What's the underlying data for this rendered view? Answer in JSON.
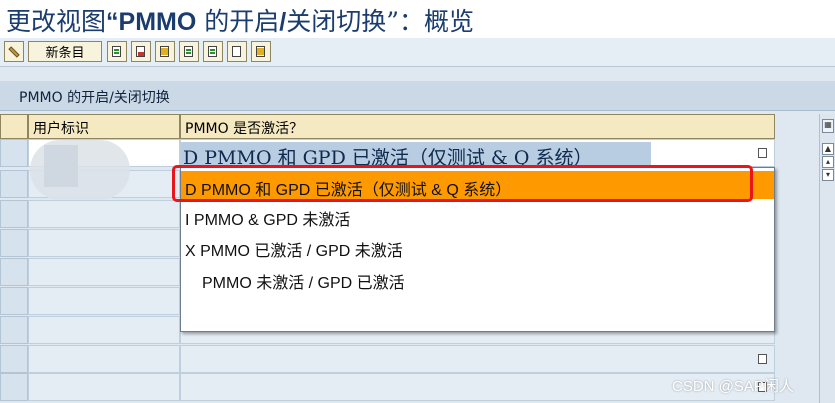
{
  "window": {
    "title": "更改视图“PMMO 的开启/关闭切换”：概览",
    "title_prefix": "更改视图",
    "title_bold": "“PMMO",
    "title_rest": " 的开启",
    "title_slash": "/",
    "title_end": "关闭切换”：概览"
  },
  "toolbar": {
    "new_entries_label": "新条目",
    "icons": [
      "edit-pencil-icon",
      "copy-icon",
      "delete-icon",
      "undo-icon",
      "select-all-icon",
      "select-block-icon",
      "deselect-icon",
      "config-icon"
    ]
  },
  "subheader": {
    "title": "PMMO 的开启/关闭切换"
  },
  "table": {
    "columns": [
      "用户标识",
      "PMMO 是否激活？"
    ],
    "selected_value": "D PMMO 和 GPD 已激活（仅测试 & Q 系统）"
  },
  "dropdown": {
    "options": [
      {
        "code": "D",
        "text": "PMMO 和 GPD 已激活（仅测试 & Q 系统）",
        "highlighted": true
      },
      {
        "code": "I",
        "text": "PMMO & GPD 未激活",
        "highlighted": false
      },
      {
        "code": "X",
        "text": "PMMO 已激活 / GPD 未激活",
        "highlighted": false
      },
      {
        "code": "",
        "text": "PMMO 未激活 / GPD 已激活",
        "highlighted": false
      }
    ]
  },
  "colors": {
    "highlight": "#ff9900",
    "annotation_box": "#e8161a",
    "header_bg": "#f5e9c2"
  },
  "watermark": "CSDN @SAP闲人"
}
